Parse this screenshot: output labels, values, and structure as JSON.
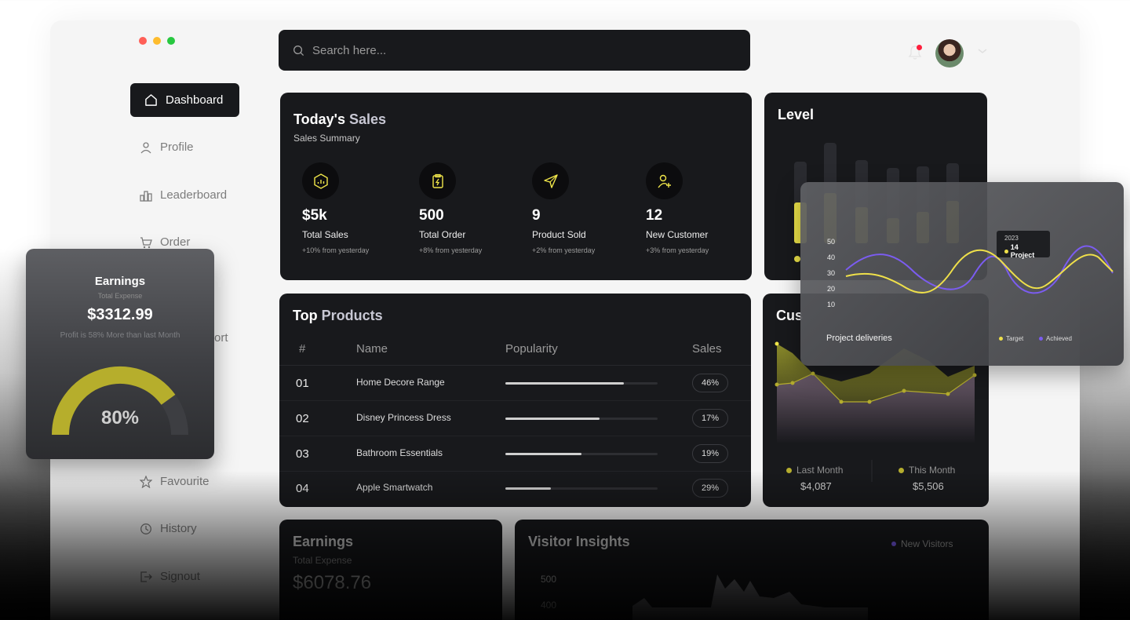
{
  "search": {
    "placeholder": "Search here..."
  },
  "nav": [
    {
      "label": "Dashboard",
      "icon": "home-icon",
      "active": true
    },
    {
      "label": "Profile",
      "icon": "user-icon"
    },
    {
      "label": "Leaderboard",
      "icon": "leaderboard-icon"
    },
    {
      "label": "Order",
      "icon": "cart-icon"
    },
    {
      "label": "Favourite",
      "icon": "star-icon"
    },
    {
      "label": "History",
      "icon": "history-icon"
    },
    {
      "label": "Signout",
      "icon": "signout-icon"
    }
  ],
  "sales": {
    "title_main": "Today's",
    "title_accent": "Sales",
    "subtitle": "Sales Summary",
    "stats": [
      {
        "value": "$5k",
        "label": "Total Sales",
        "change": "+10% from yesterday",
        "icon": "chart-hexagon-icon"
      },
      {
        "value": "500",
        "label": "Total Order",
        "change": "+8% from yesterday",
        "icon": "clipboard-icon"
      },
      {
        "value": "9",
        "label": "Product Sold",
        "change": "+2% from yesterday",
        "icon": "send-icon"
      },
      {
        "value": "12",
        "label": "New Customer",
        "change": "+3% from yesterday",
        "icon": "add-user-icon"
      }
    ]
  },
  "level": {
    "title": "Level"
  },
  "top_products": {
    "title_main": "Top",
    "title_accent": "Products",
    "columns": [
      "#",
      "Name",
      "Popularity",
      "Sales"
    ],
    "rows": [
      {
        "num": "01",
        "name": "Home Decore Range",
        "popularity": 0.78,
        "sales": "46%"
      },
      {
        "num": "02",
        "name": "Disney Princess Dress",
        "popularity": 0.62,
        "sales": "17%"
      },
      {
        "num": "03",
        "name": "Bathroom Essentials",
        "popularity": 0.5,
        "sales": "19%"
      },
      {
        "num": "04",
        "name": "Apple Smartwatch",
        "popularity": 0.3,
        "sales": "29%"
      }
    ]
  },
  "customer": {
    "title": "Cus",
    "last_label": "Last Month",
    "last_value": "$4,087",
    "this_label": "This Month",
    "this_value": "$5,506"
  },
  "earnings_bottom": {
    "title": "Earnings",
    "subtitle": "Total Expense",
    "value": "$6078.76"
  },
  "visitor": {
    "title": "Visitor Insights",
    "legend": "New Visitors",
    "ticks": [
      "500",
      "400"
    ]
  },
  "earnings_float": {
    "title": "Earnings",
    "subtitle": "Total Expense",
    "value": "$3312.99",
    "note": "Profit is 58% More than last Month",
    "gauge_percent": "80%",
    "gauge_value": 0.8
  },
  "sidebar_partial": {
    "report_suffix": "ort"
  },
  "project": {
    "title": "Project deliveries",
    "y_ticks": [
      "50",
      "40",
      "30",
      "20",
      "10"
    ],
    "tooltip_year": "2023",
    "tooltip_value": "14 Project",
    "legend_target": "Target",
    "legend_achieved": "Achieved"
  },
  "colors": {
    "accent_yellow": "#f0e64a",
    "accent_purple": "#7b5cf0",
    "card_bg": "#18191c"
  }
}
